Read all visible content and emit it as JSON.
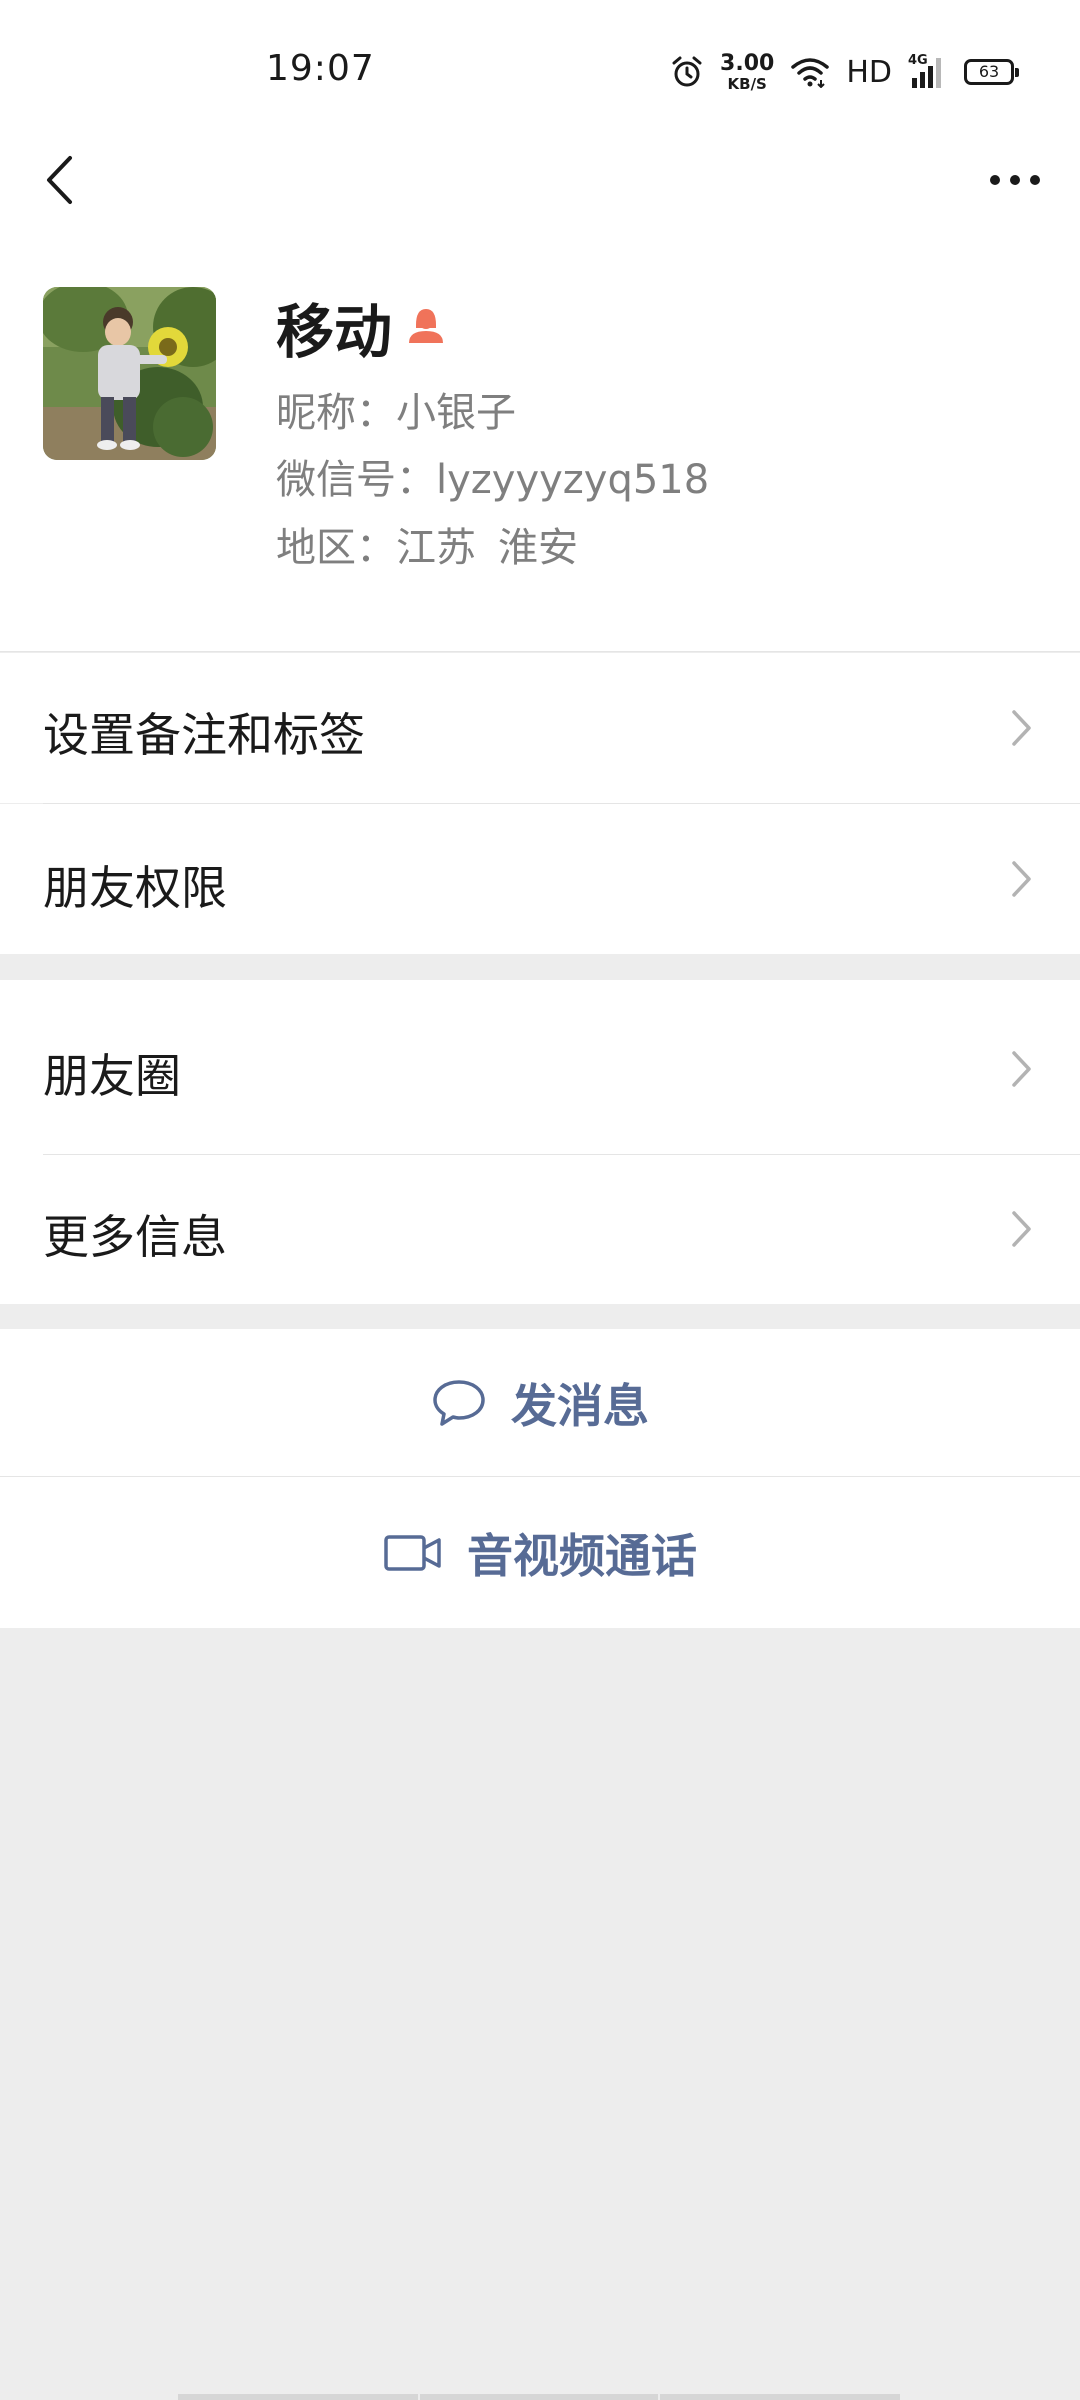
{
  "status_bar": {
    "time": "19:07",
    "net_speed_value": "3.00",
    "net_speed_unit": "KB/S",
    "hd_label": "HD",
    "network_type": "4G",
    "battery_level": "63",
    "icons": [
      "alarm-icon",
      "wifi-icon",
      "signal-icon",
      "battery-icon"
    ]
  },
  "nav": {
    "back_icon": "chevron-left-icon",
    "more_icon": "more-horizontal-icon"
  },
  "profile": {
    "name": "移动",
    "name_badge_icon": "female-user-icon",
    "name_badge_color": "#f0735a",
    "nickname": "昵称：小银子",
    "wechat_id": "微信号：lyzyyyzyq518",
    "region_label": "地区：江苏",
    "region_city": "淮安"
  },
  "menu": {
    "items": [
      {
        "label": "设置备注和标签"
      },
      {
        "label": "朋友权限"
      },
      {
        "label": "朋友圈"
      },
      {
        "label": "更多信息"
      }
    ]
  },
  "actions": {
    "send_message": "发消息",
    "video_call": "音视频通话",
    "color": "#576b95"
  }
}
